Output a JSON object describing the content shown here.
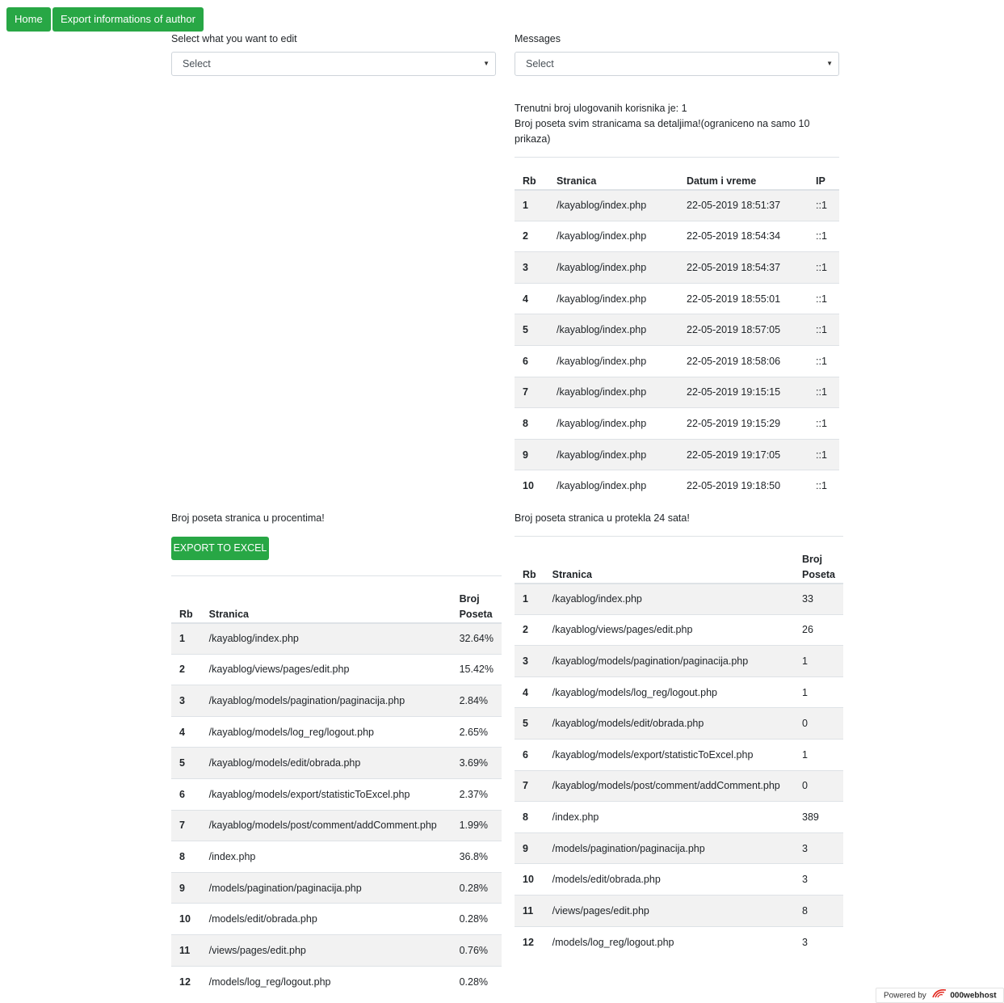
{
  "nav": {
    "home_label": "Home",
    "export_author_label": "Export informations of author"
  },
  "edit_select": {
    "label": "Select what you want to edit",
    "value": "Select"
  },
  "messages_select": {
    "label": "Messages",
    "value": "Select"
  },
  "info": {
    "logged_users": "Trenutni broj ulogovanih korisnika je: 1",
    "visits_detail": "Broj poseta svim stranicama sa detaljima!(ograniceno na samo 10 prikaza)"
  },
  "visits_table": {
    "headers": [
      "Rb",
      "Stranica",
      "Datum i vreme",
      "IP"
    ],
    "rows": [
      [
        "1",
        "/kayablog/index.php",
        "22-05-2019 18:51:37",
        "::1"
      ],
      [
        "2",
        "/kayablog/index.php",
        "22-05-2019 18:54:34",
        "::1"
      ],
      [
        "3",
        "/kayablog/index.php",
        "22-05-2019 18:54:37",
        "::1"
      ],
      [
        "4",
        "/kayablog/index.php",
        "22-05-2019 18:55:01",
        "::1"
      ],
      [
        "5",
        "/kayablog/index.php",
        "22-05-2019 18:57:05",
        "::1"
      ],
      [
        "6",
        "/kayablog/index.php",
        "22-05-2019 18:58:06",
        "::1"
      ],
      [
        "7",
        "/kayablog/index.php",
        "22-05-2019 19:15:15",
        "::1"
      ],
      [
        "8",
        "/kayablog/index.php",
        "22-05-2019 19:15:29",
        "::1"
      ],
      [
        "9",
        "/kayablog/index.php",
        "22-05-2019 19:17:05",
        "::1"
      ],
      [
        "10",
        "/kayablog/index.php",
        "22-05-2019 19:18:50",
        "::1"
      ]
    ]
  },
  "percent_section": {
    "title": "Broj poseta stranica u procentima!",
    "export_label": "EXPORT TO EXCEL",
    "headers": [
      "Rb",
      "Stranica",
      "Broj Poseta"
    ],
    "rows": [
      [
        "1",
        "/kayablog/index.php",
        "32.64%"
      ],
      [
        "2",
        "/kayablog/views/pages/edit.php",
        "15.42%"
      ],
      [
        "3",
        "/kayablog/models/pagination/paginacija.php",
        "2.84%"
      ],
      [
        "4",
        "/kayablog/models/log_reg/logout.php",
        "2.65%"
      ],
      [
        "5",
        "/kayablog/models/edit/obrada.php",
        "3.69%"
      ],
      [
        "6",
        "/kayablog/models/export/statisticToExcel.php",
        "2.37%"
      ],
      [
        "7",
        "/kayablog/models/post/comment/addComment.php",
        "1.99%"
      ],
      [
        "8",
        "/index.php",
        "36.8%"
      ],
      [
        "9",
        "/models/pagination/paginacija.php",
        "0.28%"
      ],
      [
        "10",
        "/models/edit/obrada.php",
        "0.28%"
      ],
      [
        "11",
        "/views/pages/edit.php",
        "0.76%"
      ],
      [
        "12",
        "/models/log_reg/logout.php",
        "0.28%"
      ]
    ]
  },
  "day_section": {
    "title": "Broj poseta stranica u protekla 24 sata!",
    "headers": [
      "Rb",
      "Stranica",
      "Broj Poseta"
    ],
    "rows": [
      [
        "1",
        "/kayablog/index.php",
        "33"
      ],
      [
        "2",
        "/kayablog/views/pages/edit.php",
        "26"
      ],
      [
        "3",
        "/kayablog/models/pagination/paginacija.php",
        "1"
      ],
      [
        "4",
        "/kayablog/models/log_reg/logout.php",
        "1"
      ],
      [
        "5",
        "/kayablog/models/edit/obrada.php",
        "0"
      ],
      [
        "6",
        "/kayablog/models/export/statisticToExcel.php",
        "1"
      ],
      [
        "7",
        "/kayablog/models/post/comment/addComment.php",
        "0"
      ],
      [
        "8",
        "/index.php",
        "389"
      ],
      [
        "9",
        "/models/pagination/paginacija.php",
        "3"
      ],
      [
        "10",
        "/models/edit/obrada.php",
        "3"
      ],
      [
        "11",
        "/views/pages/edit.php",
        "8"
      ],
      [
        "12",
        "/models/log_reg/logout.php",
        "3"
      ]
    ]
  },
  "footer": {
    "powered_label": "Powered by",
    "brand": "000webhost",
    "logo_icon": "webhost-swoosh-icon",
    "accent": "#28a745"
  }
}
